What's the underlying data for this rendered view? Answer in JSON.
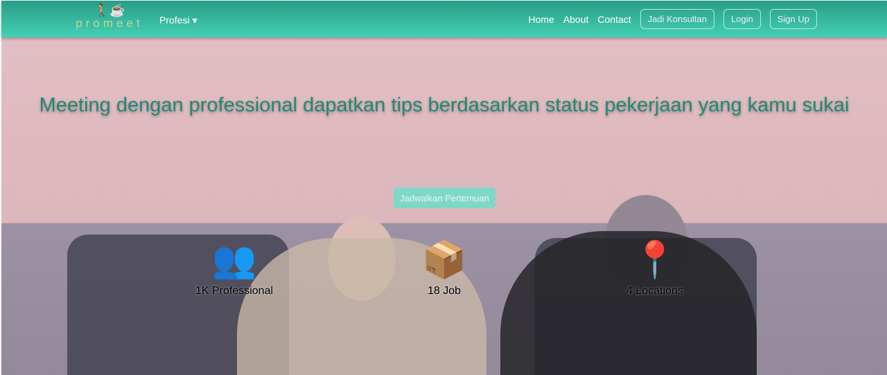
{
  "nav": {
    "brand": "promeet",
    "profesi": "Profesi",
    "links": [
      "Home",
      "About",
      "Contact"
    ],
    "buttons": [
      "Jadi Konsultan",
      "Login",
      "Sign Up"
    ]
  },
  "hero": {
    "headline": "Meeting dengan professional dapatkan tips berdasarkan status pekerjaan yang kamu sukai",
    "cta": "Jadwalkan Pertemuan",
    "stats": [
      {
        "icon": "people-icon",
        "glyph": "👥",
        "label": "1K Professional"
      },
      {
        "icon": "package-hand-icon",
        "glyph": "📦",
        "label": "18 Job"
      },
      {
        "icon": "map-pin-icon",
        "glyph": "📍",
        "label": "4 Locations"
      }
    ]
  }
}
